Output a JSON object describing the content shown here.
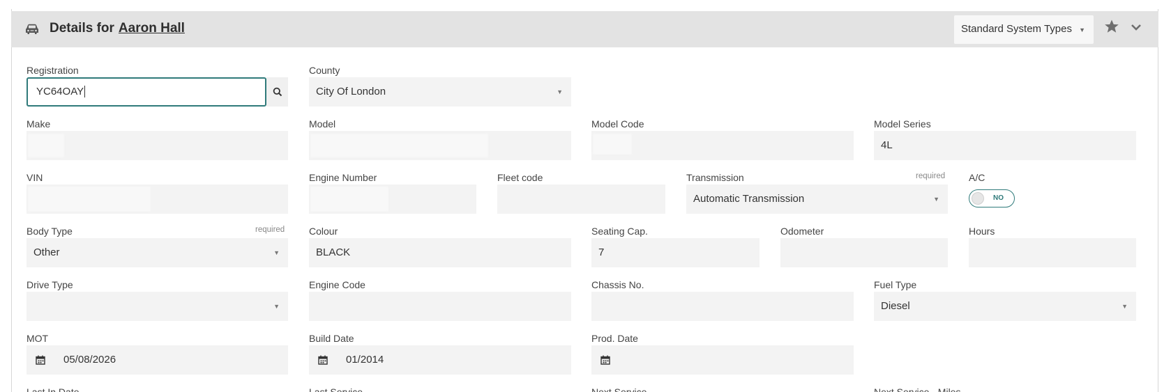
{
  "header": {
    "title_prefix": "Details for",
    "title_name": "Aaron Hall",
    "system_types": "Standard System Types"
  },
  "fields": {
    "registration": {
      "label": "Registration",
      "value": "YC64OAY"
    },
    "county": {
      "label": "County",
      "value": "City Of London"
    },
    "make": {
      "label": "Make"
    },
    "model": {
      "label": "Model"
    },
    "model_code": {
      "label": "Model Code"
    },
    "model_series": {
      "label": "Model Series",
      "value": "4L"
    },
    "vin": {
      "label": "VIN"
    },
    "engine_number": {
      "label": "Engine Number"
    },
    "fleet_code": {
      "label": "Fleet code"
    },
    "transmission": {
      "label": "Transmission",
      "required": "required",
      "value": "Automatic Transmission"
    },
    "ac": {
      "label": "A/C",
      "value": "NO"
    },
    "body_type": {
      "label": "Body Type",
      "required": "required",
      "value": "Other"
    },
    "colour": {
      "label": "Colour",
      "value": "BLACK"
    },
    "seating": {
      "label": "Seating Cap.",
      "value": "7"
    },
    "odometer": {
      "label": "Odometer"
    },
    "hours": {
      "label": "Hours"
    },
    "drive_type": {
      "label": "Drive Type"
    },
    "engine_code": {
      "label": "Engine Code"
    },
    "chassis": {
      "label": "Chassis No."
    },
    "fuel_type": {
      "label": "Fuel Type",
      "value": "Diesel"
    },
    "mot": {
      "label": "MOT",
      "value": "05/08/2026"
    },
    "build_date": {
      "label": "Build Date",
      "value": "01/2014"
    },
    "prod_date": {
      "label": "Prod. Date"
    },
    "last_in_date": {
      "label": "Last In Date"
    },
    "last_service": {
      "label": "Last Service"
    },
    "next_service": {
      "label": "Next Service"
    },
    "next_service_miles": {
      "label": "Next Service - Miles"
    }
  },
  "colors": {
    "accent": "#2f7a7a",
    "header_bg": "#e3e3e3",
    "field_bg": "#f3f3f3"
  },
  "icons": [
    "car-icon",
    "search-icon",
    "star-icon",
    "chevron-down-icon",
    "calendar-icon",
    "dropdown-caret-icon"
  ]
}
